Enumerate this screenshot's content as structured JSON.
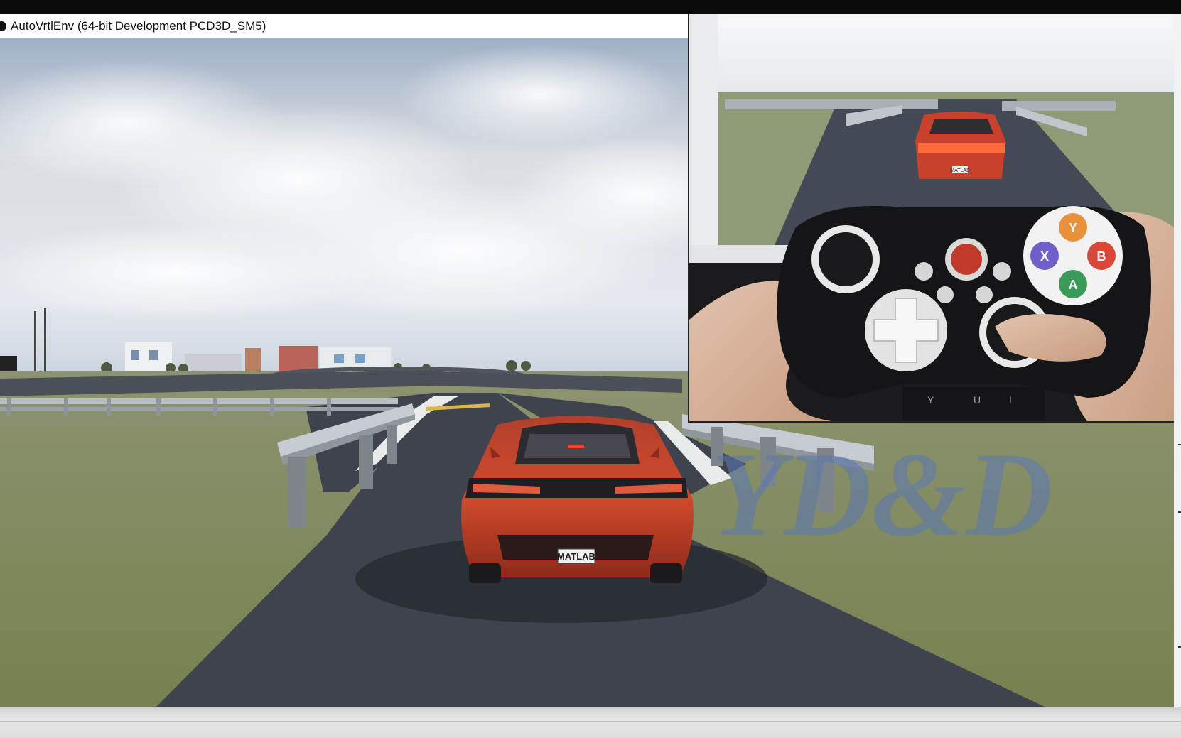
{
  "window": {
    "title": "AutoVrtlEnv (64-bit Development PCD3D_SM5)"
  },
  "scene": {
    "plate_text": "MATLAB"
  },
  "watermark": {
    "text": "YD&D"
  },
  "inset": {
    "plate_text": "MATLAB",
    "keyboard_keys": [
      "Y",
      "U",
      "I"
    ],
    "gamepad_buttons": [
      "Y",
      "B",
      "X",
      "A"
    ]
  },
  "colors": {
    "car_red": "#c8412c",
    "road": "#3f434d",
    "grass": "#7e8a5c",
    "sky": "#d6dde6",
    "watermark": "#5a78b8"
  }
}
